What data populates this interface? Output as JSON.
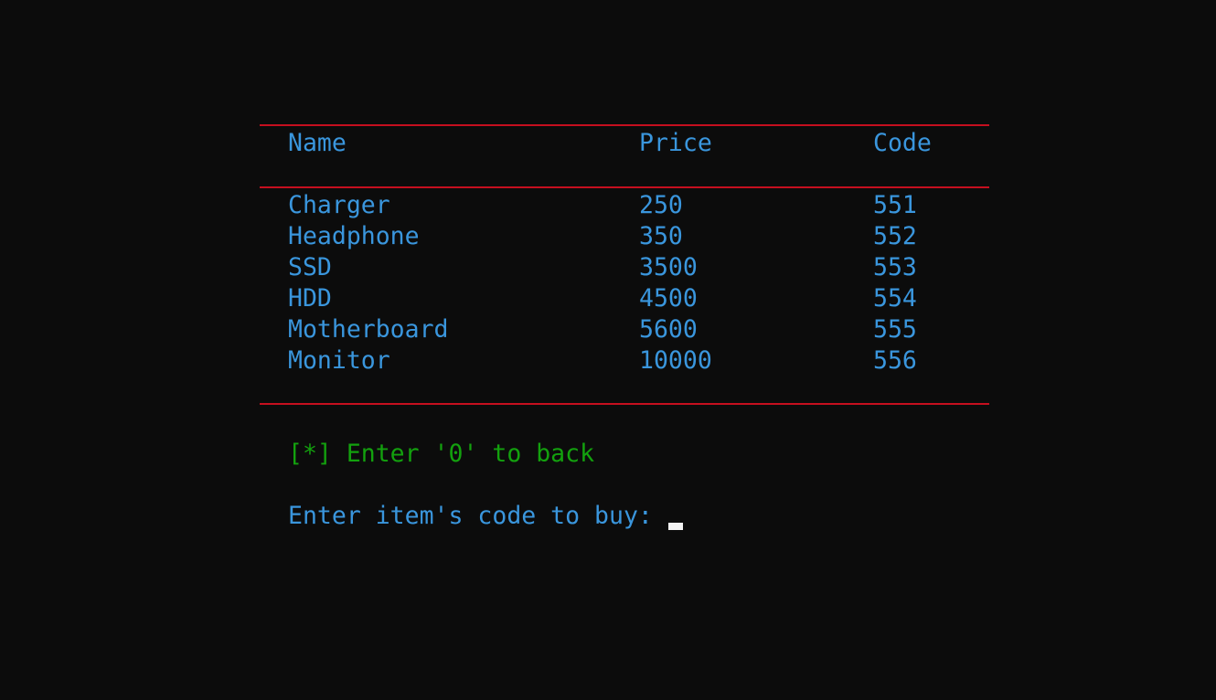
{
  "table": {
    "headers": {
      "name": "Name",
      "price": "Price",
      "code": "Code"
    },
    "rows": [
      {
        "name": "Charger",
        "price": "250",
        "code": "551"
      },
      {
        "name": "Headphone",
        "price": "350",
        "code": "552"
      },
      {
        "name": "SSD",
        "price": "3500",
        "code": "553"
      },
      {
        "name": "HDD",
        "price": "4500",
        "code": "554"
      },
      {
        "name": "Motherboard",
        "price": "5600",
        "code": "555"
      },
      {
        "name": "Monitor",
        "price": "10000",
        "code": "556"
      }
    ]
  },
  "hint": {
    "text": "[*] Enter '0' to back"
  },
  "prompt": {
    "label": "Enter item's code to buy:",
    "value": ""
  },
  "colors": {
    "background": "#0c0c0c",
    "text": "#3a96dd",
    "rule": "#c50f1f",
    "hint": "#13a10e",
    "cursor": "#f2f2f2"
  }
}
